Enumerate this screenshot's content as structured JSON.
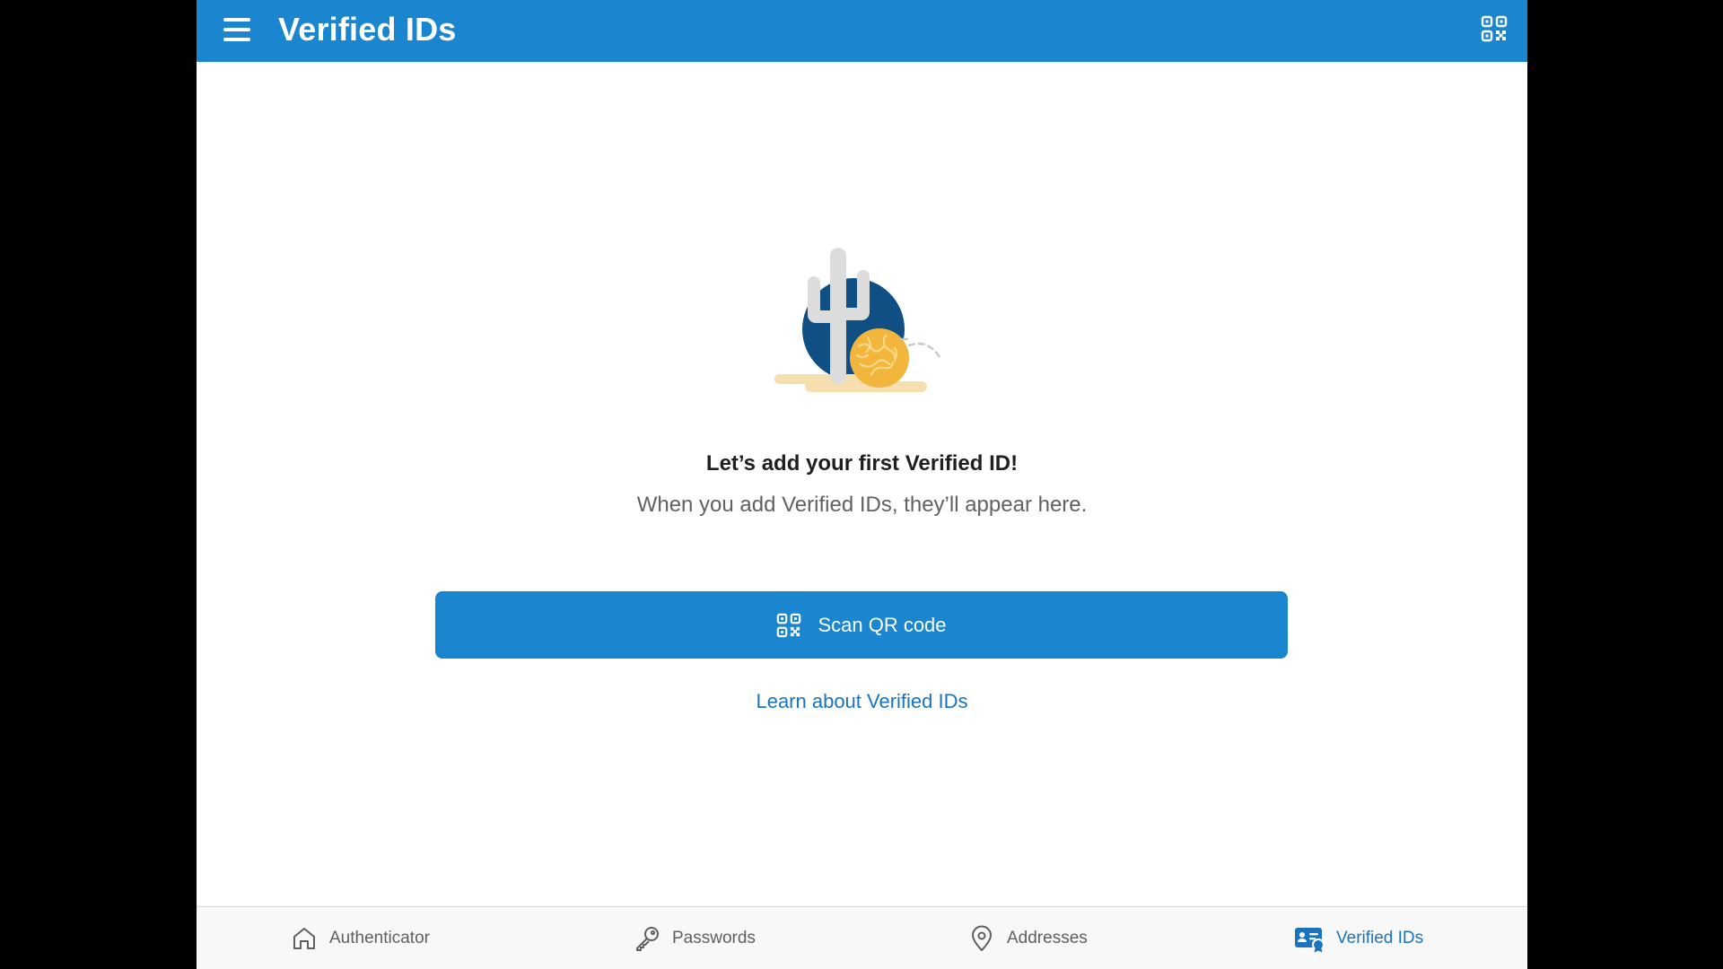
{
  "header": {
    "title": "Verified IDs",
    "menu_icon": "hamburger-menu-icon",
    "qr_icon": "qr-code-icon"
  },
  "empty_state": {
    "illustration": "cactus-tumbleweed-illustration",
    "title": "Let’s add your first Verified ID!",
    "subtitle": "When you add Verified IDs, they’ll appear here."
  },
  "actions": {
    "scan_label": "Scan QR code",
    "scan_icon": "qr-code-icon",
    "learn_label": "Learn about Verified IDs"
  },
  "nav": {
    "items": [
      {
        "label": "Authenticator",
        "icon": "home-icon",
        "active": false
      },
      {
        "label": "Passwords",
        "icon": "key-icon",
        "active": false
      },
      {
        "label": "Addresses",
        "icon": "location-pin-icon",
        "active": false
      },
      {
        "label": "Verified IDs",
        "icon": "verified-id-card-icon",
        "active": true
      }
    ]
  },
  "colors": {
    "accent": "#1a86d0",
    "link": "#1a74bd",
    "background": "#ffffff",
    "nav_background": "#f8f8f8"
  }
}
